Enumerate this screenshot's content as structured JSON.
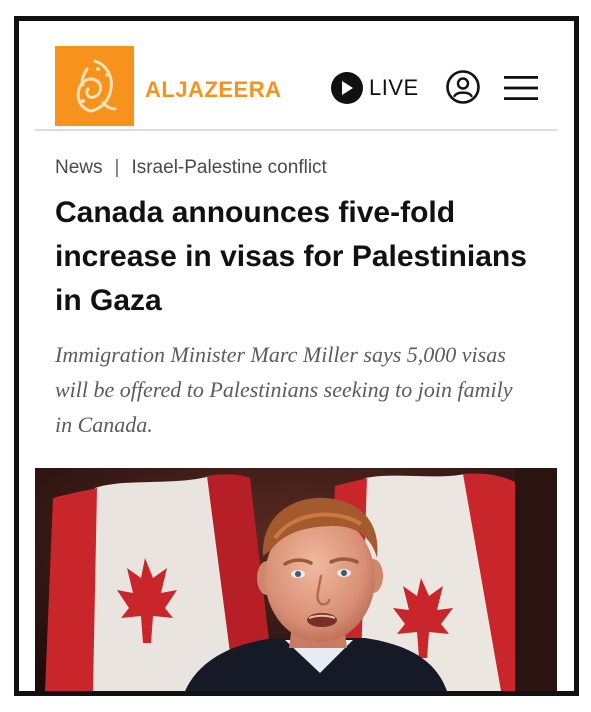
{
  "header": {
    "brand_name": "ALJAZEERA",
    "live_label": "LIVE",
    "brand_color": "#f7931d",
    "icons": [
      "aljazeera-logo-icon",
      "play-icon",
      "account-icon",
      "menu-icon"
    ]
  },
  "breadcrumb": {
    "section": "News",
    "separator": "|",
    "topic": "Israel-Palestine conflict"
  },
  "article": {
    "headline": "Canada announces five-fold increase in visas for Palestinians in Gaza",
    "standfirst": "Immigration Minister Marc Miller says 5,000 visas will be offered to Palestinians seeking to join family in Canada."
  }
}
